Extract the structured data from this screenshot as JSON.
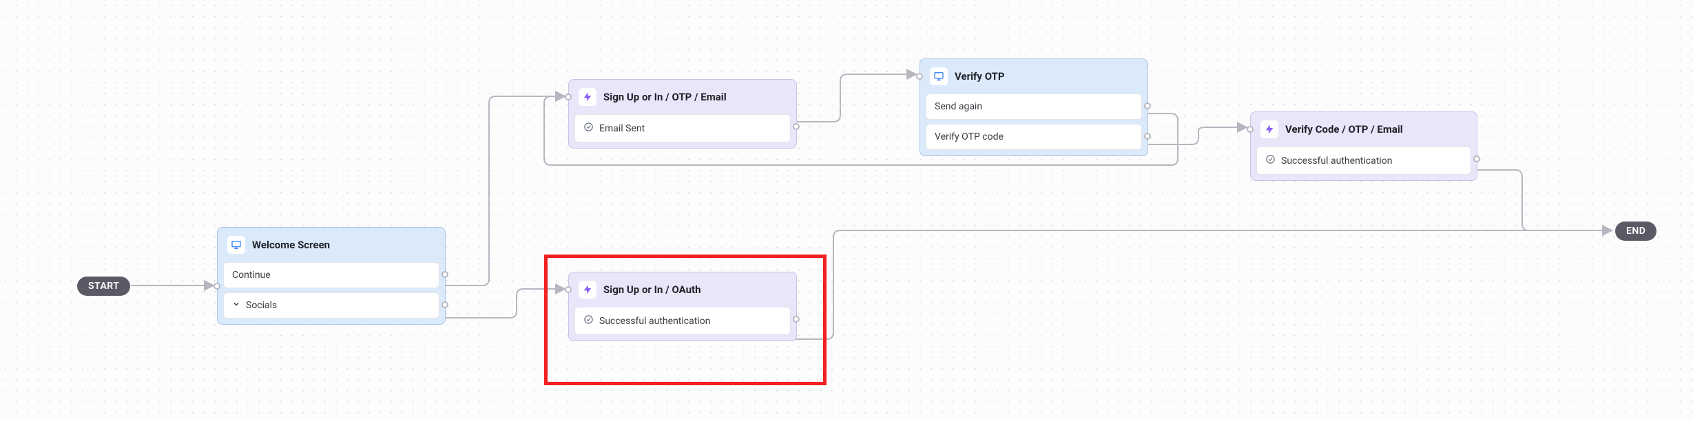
{
  "start_label": "START",
  "end_label": "END",
  "nodes": {
    "welcome": {
      "title": "Welcome Screen",
      "rows": [
        "Continue",
        "Socials"
      ]
    },
    "signup_otp": {
      "title": "Sign Up or In / OTP / Email",
      "rows": [
        "Email Sent"
      ]
    },
    "verify_otp": {
      "title": "Verify OTP",
      "rows": [
        "Send again",
        "Verify OTP code"
      ]
    },
    "verify_code_email": {
      "title": "Verify Code / OTP / Email",
      "rows": [
        "Successful authentication"
      ]
    },
    "signup_oauth": {
      "title": "Sign Up or In / OAuth",
      "rows": [
        "Successful authentication"
      ]
    }
  },
  "icons": {
    "monitor": "monitor-icon",
    "bolt": "bolt-icon",
    "check": "check-circle-icon",
    "chevron": "chevron-down-icon"
  }
}
